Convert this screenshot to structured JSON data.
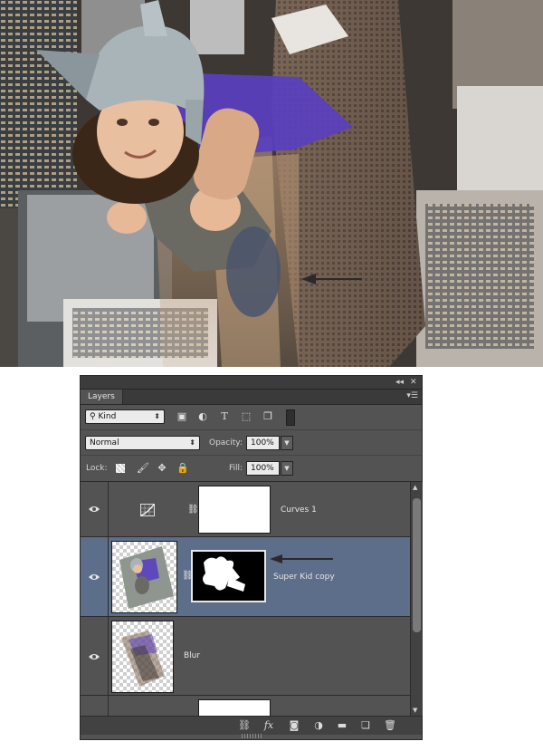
{
  "panel": {
    "tab_label": "Layers",
    "collapse_icon": "double-chevron-left-icon",
    "close_icon": "close-icon",
    "menu_icon": "panel-menu-icon",
    "filter": {
      "kind_label": "Kind",
      "icons": [
        "image-filter-icon",
        "adjustment-filter-icon",
        "type-filter-icon",
        "shape-filter-icon",
        "smart-object-filter-icon",
        "filter-toggle-icon"
      ]
    },
    "blend": {
      "mode": "Normal",
      "opacity_label": "Opacity:",
      "opacity_value": "100%"
    },
    "lock": {
      "label": "Lock:",
      "icons": [
        "lock-transparent-icon",
        "lock-image-icon",
        "lock-position-icon",
        "lock-all-icon"
      ],
      "fill_label": "Fill:",
      "fill_value": "100%"
    },
    "layers": [
      {
        "name": "Curves 1",
        "type": "adjustment",
        "visible": true,
        "selected": false
      },
      {
        "name": "Super Kid copy",
        "type": "masked",
        "visible": true,
        "selected": true
      },
      {
        "name": "Blur",
        "type": "pixel",
        "visible": true,
        "selected": false
      },
      {
        "name": "",
        "type": "partial",
        "visible": false,
        "selected": false
      }
    ],
    "footer_icons": [
      "link-layers-icon",
      "fx-icon",
      "add-mask-icon",
      "new-adjustment-icon",
      "new-group-icon",
      "new-layer-icon",
      "trash-icon"
    ],
    "fx_label": "fx"
  },
  "colors": {
    "panel_bg": "#535353",
    "selected_row": "#5d6e8a",
    "cape_purple": "#5a3fc0",
    "helmet_silver": "#a9b4b8"
  }
}
